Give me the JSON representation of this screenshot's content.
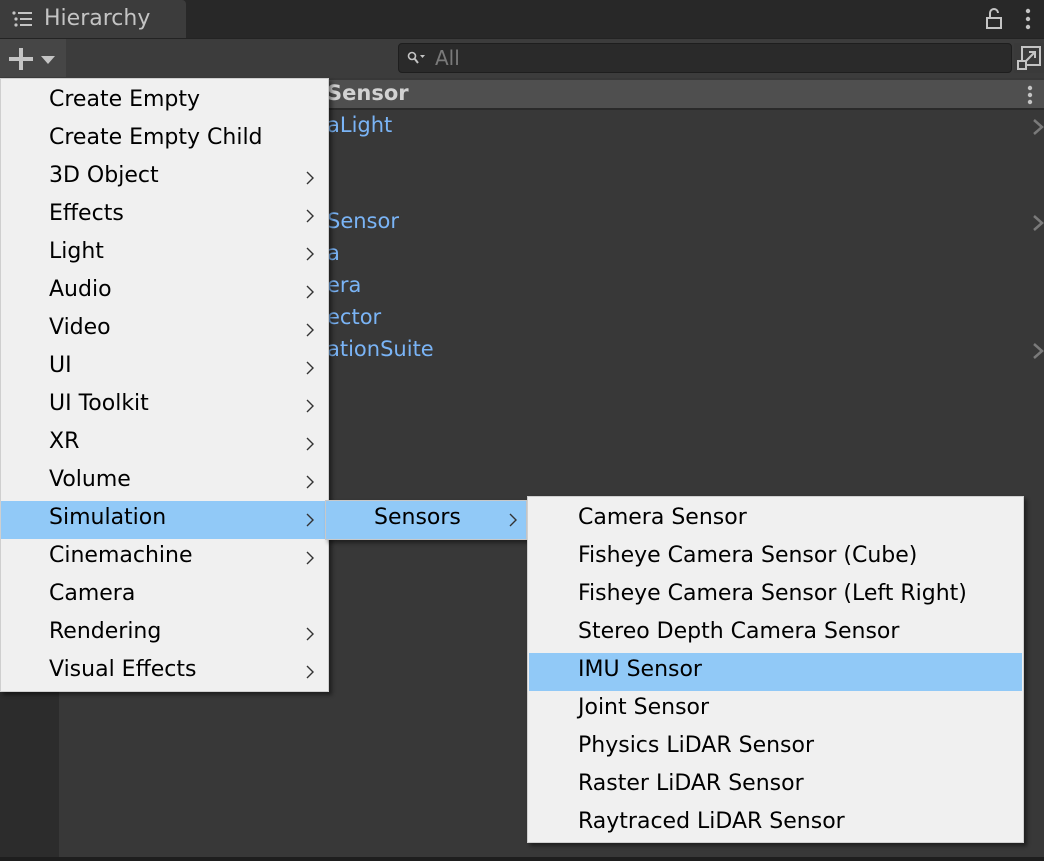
{
  "window": {
    "tab_label": "Hierarchy",
    "tab_icon": "list-icon",
    "lock_icon": "lock-icon",
    "more_icon": "kebab-icon"
  },
  "toolbar": {
    "create_button_icon": "plus-icon",
    "create_dropdown_icon": "triangle-down-icon",
    "search": {
      "value": "",
      "placeholder": "All",
      "icon": "search-icon"
    },
    "popout_icon": "popout-icon"
  },
  "hierarchy": {
    "scene_title_visible": "Sensor",
    "rows": [
      {
        "label_visible": "aLight",
        "has_children": true
      },
      {
        "label_visible": "Sensor",
        "has_children": true
      },
      {
        "label_visible": "a",
        "has_children": false
      },
      {
        "label_visible": "era",
        "has_children": false
      },
      {
        "label_visible": "ector",
        "has_children": false
      },
      {
        "label_visible": "ationSuite",
        "has_children": true
      }
    ]
  },
  "menus": {
    "main": {
      "items": [
        {
          "label": "Create Empty",
          "submenu": false
        },
        {
          "label": "Create Empty Child",
          "submenu": false
        },
        {
          "label": "3D Object",
          "submenu": true
        },
        {
          "label": "Effects",
          "submenu": true
        },
        {
          "label": "Light",
          "submenu": true
        },
        {
          "label": "Audio",
          "submenu": true
        },
        {
          "label": "Video",
          "submenu": true
        },
        {
          "label": "UI",
          "submenu": true
        },
        {
          "label": "UI Toolkit",
          "submenu": true
        },
        {
          "label": "XR",
          "submenu": true
        },
        {
          "label": "Volume",
          "submenu": true
        },
        {
          "label": "Simulation",
          "submenu": true,
          "highlighted": true
        },
        {
          "label": "Cinemachine",
          "submenu": true
        },
        {
          "label": "Camera",
          "submenu": false
        },
        {
          "label": "Rendering",
          "submenu": true
        },
        {
          "label": "Visual Effects",
          "submenu": true
        }
      ]
    },
    "simulation": {
      "items": [
        {
          "label": "Sensors",
          "submenu": true,
          "highlighted": true
        }
      ]
    },
    "sensors": {
      "items": [
        {
          "label": "Camera Sensor"
        },
        {
          "label": "Fisheye Camera Sensor (Cube)"
        },
        {
          "label": "Fisheye Camera Sensor (Left Right)"
        },
        {
          "label": "Stereo Depth Camera Sensor"
        },
        {
          "label": "IMU Sensor",
          "highlighted": true
        },
        {
          "label": "Joint Sensor"
        },
        {
          "label": "Physics LiDAR Sensor"
        },
        {
          "label": "Raster LiDAR Sensor"
        },
        {
          "label": "Raytraced LiDAR Sensor"
        }
      ]
    }
  },
  "colors": {
    "highlight": "#91c9f7",
    "menu_bg": "#f0f0f0",
    "object_text": "#7ab4f6",
    "panel_bg": "#383838"
  }
}
